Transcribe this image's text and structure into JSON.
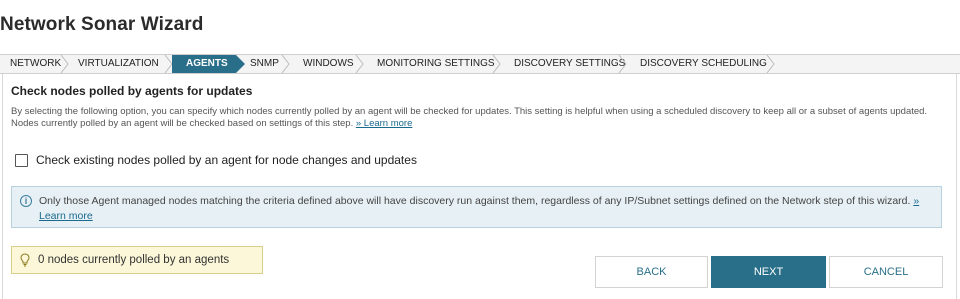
{
  "page_title": "Network Sonar Wizard",
  "steps": [
    {
      "label": "NETWORK",
      "active": false
    },
    {
      "label": "VIRTUALIZATION",
      "active": false
    },
    {
      "label": "AGENTS",
      "active": true
    },
    {
      "label": "SNMP",
      "active": false
    },
    {
      "label": "WINDOWS",
      "active": false
    },
    {
      "label": "MONITORING SETTINGS",
      "active": false
    },
    {
      "label": "DISCOVERY SETTINGS",
      "active": false
    },
    {
      "label": "DISCOVERY SCHEDULING",
      "active": false
    }
  ],
  "section": {
    "heading": "Check nodes polled by agents for updates",
    "description": "By selecting the following option, you can specify which nodes currently polled by an agent will be checked for updates. This setting is helpful when using a scheduled discovery to keep all or a subset of agents updated. Nodes currently polled by an agent will be checked based on settings of this step.",
    "learn_more": "» Learn more"
  },
  "checkbox": {
    "label": "Check existing nodes polled by an agent for node changes and updates",
    "checked": false
  },
  "info": {
    "icon": "info-icon",
    "text": "Only those Agent managed nodes matching the criteria defined above will have discovery run against them, regardless of any IP/Subnet settings defined on the Network step of this wizard.",
    "learn_more": "» Learn more"
  },
  "notice": {
    "icon": "lightbulb-icon",
    "text": "0 nodes currently polled by an agents"
  },
  "buttons": {
    "back": "BACK",
    "next": "NEXT",
    "cancel": "CANCEL"
  },
  "colors": {
    "accent": "#2a6f89",
    "info_bg": "#e7f0f5",
    "notice_bg": "#fbf7d8"
  }
}
